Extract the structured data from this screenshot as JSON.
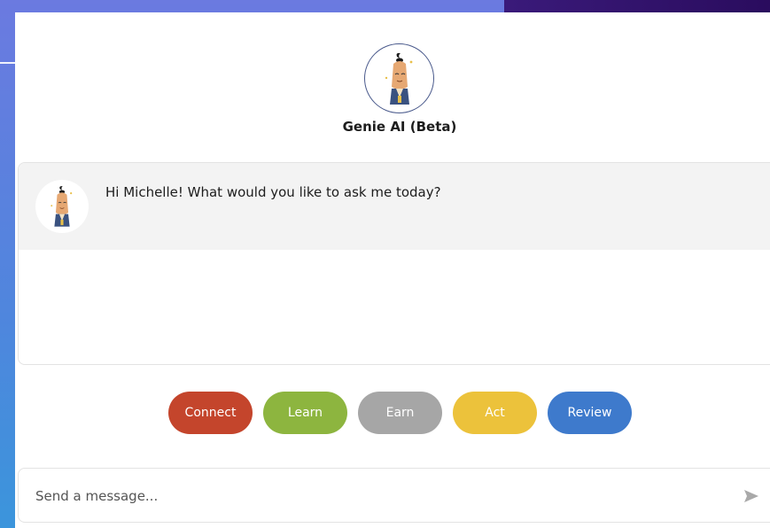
{
  "header": {
    "title": "Genie AI (Beta)",
    "avatar_icon": "genie-mascot-icon"
  },
  "chat": {
    "messages": [
      {
        "sender_icon": "genie-mascot-icon",
        "text": "Hi Michelle! What would you like to ask me today?"
      }
    ]
  },
  "quick_actions": [
    {
      "label": "Connect",
      "color": "#c4452c"
    },
    {
      "label": "Learn",
      "color": "#8db53f"
    },
    {
      "label": "Earn",
      "color": "#a6a6a6"
    },
    {
      "label": "Act",
      "color": "#ecc23b"
    },
    {
      "label": "Review",
      "color": "#3e7acc"
    }
  ],
  "composer": {
    "placeholder": "Send a message...",
    "send_icon": "send-icon"
  }
}
